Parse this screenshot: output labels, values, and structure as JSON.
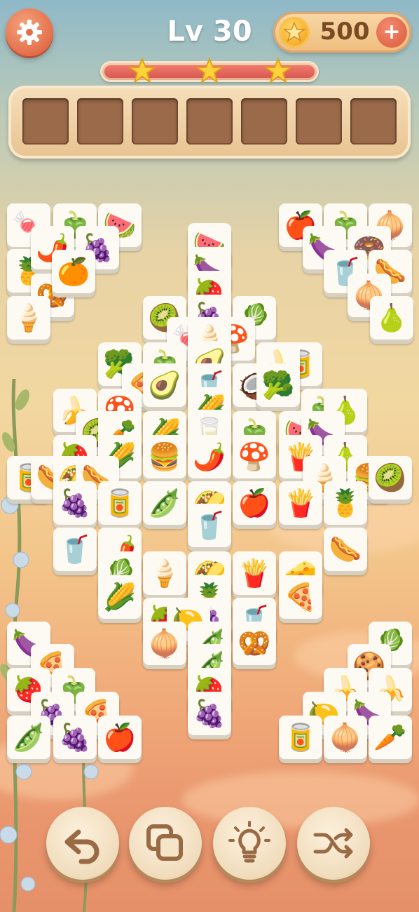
{
  "level": {
    "label": "Lv 30"
  },
  "coins": {
    "amount": "500",
    "plus_label": "+"
  },
  "progress": {
    "fill_fraction": 1.0,
    "stars": 3
  },
  "tray": {
    "slot_count": 7
  },
  "colors": {
    "accent": "#e36f4a",
    "tray_slot": "#9a6a4a",
    "tile_face": "#fdfaf3",
    "coin": "#f3a928"
  },
  "icons": {
    "settings": "gear-icon",
    "coin": "star-coin-icon",
    "buy": "plus-icon",
    "undo": "undo-arrow-icon",
    "copy": "copy-icon",
    "hint": "lightbulb-icon",
    "shuffle": "shuffle-icon"
  },
  "tiles": [
    {
      "id": "candy",
      "e": "🍬"
    },
    {
      "id": "pepper",
      "e": "🫑"
    },
    {
      "id": "watermelon",
      "e": "🍉"
    },
    {
      "id": "chili",
      "e": "🌶️"
    },
    {
      "id": "grapes",
      "e": "🍇"
    },
    {
      "id": "orange",
      "e": "🍊"
    },
    {
      "id": "pineapple",
      "e": "🍍"
    },
    {
      "id": "pretzel",
      "e": "🥨"
    },
    {
      "id": "icecream",
      "e": "🍦"
    },
    {
      "id": "apple",
      "e": "🍎"
    },
    {
      "id": "mangosteen",
      "e": "🍆"
    },
    {
      "id": "donut",
      "e": "🍩"
    },
    {
      "id": "cola",
      "e": "🥤"
    },
    {
      "id": "hotdog",
      "e": "🌭"
    },
    {
      "id": "onion",
      "e": "🧅"
    },
    {
      "id": "pear",
      "e": "🍐"
    },
    {
      "id": "raspberry",
      "e": "🍓"
    },
    {
      "id": "kiwi",
      "e": "🥝"
    },
    {
      "id": "lettuce",
      "e": "🥬"
    },
    {
      "id": "mushroom",
      "e": "🍄"
    },
    {
      "id": "broccoli",
      "e": "🥦"
    },
    {
      "id": "avocado",
      "e": "🥑"
    },
    {
      "id": "can",
      "e": "🥫"
    },
    {
      "id": "pizza",
      "e": "🍕"
    },
    {
      "id": "coconut",
      "e": "🥥"
    },
    {
      "id": "banana",
      "e": "🍌"
    },
    {
      "id": "carrot",
      "e": "🥕"
    },
    {
      "id": "corn",
      "e": "🌽"
    },
    {
      "id": "milk",
      "e": "🥛"
    },
    {
      "id": "burger",
      "e": "🍔"
    },
    {
      "id": "fries",
      "e": "🍟"
    },
    {
      "id": "taco",
      "e": "🌮"
    },
    {
      "id": "peas",
      "e": "🫛"
    },
    {
      "id": "cheese",
      "e": "🧀"
    },
    {
      "id": "lemon",
      "e": "🍋"
    },
    {
      "id": "cookie",
      "e": "🍪"
    },
    {
      "id": "strawberry",
      "e": "🍓"
    },
    {
      "id": "eggplant",
      "e": "🍆"
    }
  ]
}
